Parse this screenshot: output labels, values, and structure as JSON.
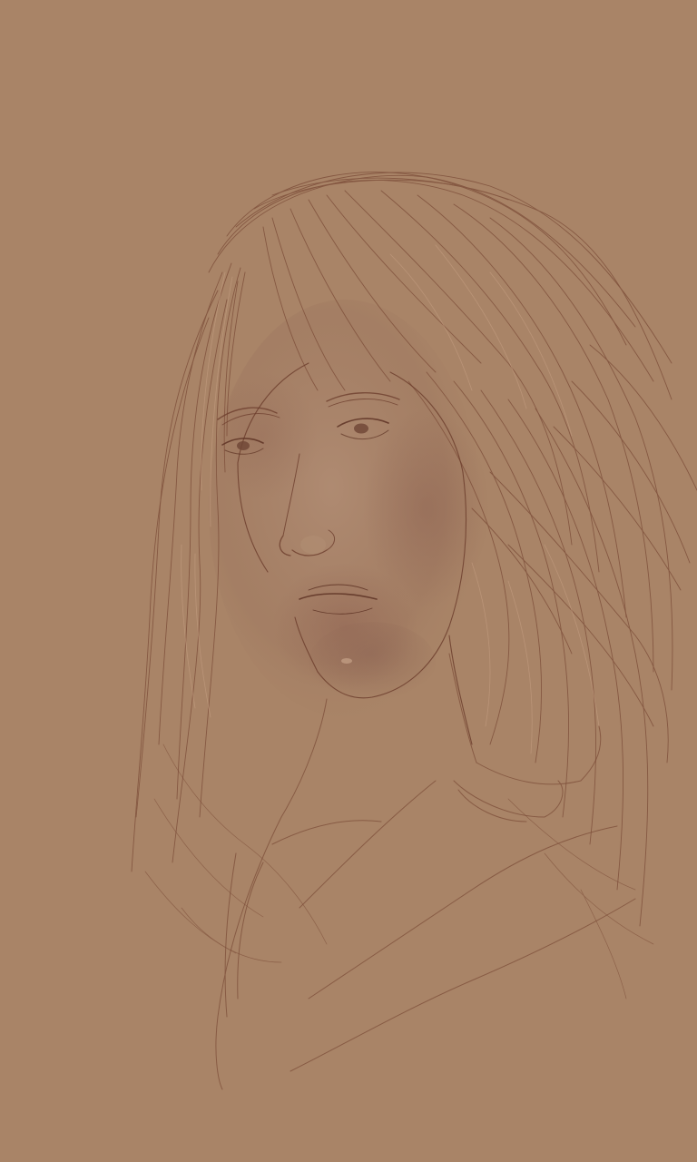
{
  "artwork": {
    "subject": "pencil-sketch-portrait",
    "colors": {
      "paper": "#a98467",
      "line_dark": "#6e3f2e",
      "line_mid": "#8a5540",
      "line_light": "#c9a286",
      "highlight": "#e3c2a6",
      "shadow": "#8a6450"
    }
  }
}
